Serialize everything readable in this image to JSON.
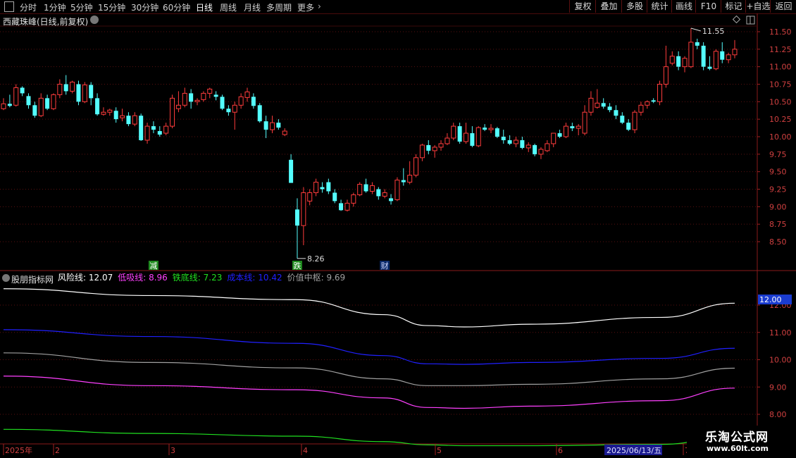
{
  "toolbar": {
    "periods": [
      "分时",
      "1分钟",
      "5分钟",
      "15分钟",
      "30分钟",
      "60分钟",
      "日线",
      "周线",
      "月线",
      "多周期",
      "更多"
    ],
    "active_period": "日线",
    "buttons": [
      "复权",
      "叠加",
      "多股",
      "统计",
      "画线",
      "F10",
      "标记",
      "+自选",
      "返回"
    ]
  },
  "main_panel": {
    "title": "西藏珠峰(日线,前复权)",
    "high_label": "11.55",
    "low_label": "8.26"
  },
  "events": [
    {
      "text": "减",
      "bg": "#1e8a1e",
      "fg": "#ffffff"
    },
    {
      "text": "跌",
      "bg": "#1e8a1e",
      "fg": "#ffffff"
    },
    {
      "text": "财",
      "bg": "#0a2a6a",
      "fg": "#d0d8ff"
    }
  ],
  "indicator": {
    "name": "股朋指标网",
    "lines": [
      {
        "label": "风险线: 12.07",
        "color": "#ffffff"
      },
      {
        "label": "低吸线: 8.96",
        "color": "#ff40ff"
      },
      {
        "label": "铁底线: 7.23",
        "color": "#20e020"
      },
      {
        "label": "成本线: 10.42",
        "color": "#2020ff"
      },
      {
        "label": "价值中枢: 9.69",
        "color": "#a0a0a0"
      }
    ],
    "current_value_tag": "12.00"
  },
  "date_axis": {
    "labels": [
      "2025年",
      "2",
      "3",
      "4",
      "5",
      "6",
      "7"
    ],
    "cursor_date": "2025/06/13/五"
  },
  "watermark": {
    "title": "乐淘公式网",
    "url": "www.60lt.com"
  },
  "chart_data": [
    {
      "type": "candlestick",
      "title": "西藏珠峰(日线,前复权)",
      "ylim": [
        8.3,
        11.65
      ],
      "yticks": [
        "11.50",
        "11.25",
        "11.00",
        "10.75",
        "10.50",
        "10.25",
        "10.00",
        "9.75",
        "9.50",
        "9.25",
        "9.00",
        "8.75",
        "8.50"
      ],
      "ohlc": [
        [
          10.4,
          10.55,
          10.38,
          10.47
        ],
        [
          10.47,
          10.6,
          10.42,
          10.44
        ],
        [
          10.45,
          10.75,
          10.43,
          10.7
        ],
        [
          10.7,
          10.72,
          10.58,
          10.62
        ],
        [
          10.58,
          10.62,
          10.4,
          10.45
        ],
        [
          10.45,
          10.5,
          10.27,
          10.3
        ],
        [
          10.3,
          10.62,
          10.28,
          10.55
        ],
        [
          10.55,
          10.6,
          10.38,
          10.4
        ],
        [
          10.4,
          10.62,
          10.38,
          10.6
        ],
        [
          10.6,
          10.82,
          10.55,
          10.75
        ],
        [
          10.75,
          10.88,
          10.6,
          10.65
        ],
        [
          10.65,
          10.8,
          10.62,
          10.78
        ],
        [
          10.75,
          10.8,
          10.45,
          10.5
        ],
        [
          10.5,
          10.78,
          10.48,
          10.74
        ],
        [
          10.74,
          10.78,
          10.45,
          10.55
        ],
        [
          10.55,
          10.62,
          10.3,
          10.32
        ],
        [
          10.32,
          10.42,
          10.3,
          10.35
        ],
        [
          10.35,
          10.4,
          10.3,
          10.38
        ],
        [
          10.37,
          10.42,
          10.2,
          10.25
        ],
        [
          10.27,
          10.4,
          10.22,
          10.3
        ],
        [
          10.3,
          10.35,
          10.15,
          10.18
        ],
        [
          10.18,
          10.35,
          10.15,
          10.3
        ],
        [
          10.3,
          10.33,
          9.94,
          9.95
        ],
        [
          9.95,
          10.2,
          9.9,
          10.15
        ],
        [
          10.15,
          10.22,
          10.05,
          10.1
        ],
        [
          10.08,
          10.15,
          10.0,
          10.03
        ],
        [
          10.05,
          10.2,
          10.02,
          10.15
        ],
        [
          10.15,
          10.6,
          10.12,
          10.55
        ],
        [
          10.4,
          10.65,
          10.35,
          10.45
        ],
        [
          10.45,
          10.7,
          10.42,
          10.62
        ],
        [
          10.62,
          10.68,
          10.4,
          10.5
        ],
        [
          10.5,
          10.55,
          10.45,
          10.52
        ],
        [
          10.53,
          10.65,
          10.5,
          10.62
        ],
        [
          10.62,
          10.7,
          10.55,
          10.68
        ],
        [
          10.6,
          10.65,
          10.52,
          10.57
        ],
        [
          10.57,
          10.6,
          10.38,
          10.4
        ],
        [
          10.4,
          10.45,
          10.3,
          10.35
        ],
        [
          10.35,
          10.5,
          10.1,
          10.45
        ],
        [
          10.45,
          10.62,
          10.4,
          10.57
        ],
        [
          10.56,
          10.7,
          10.5,
          10.64
        ],
        [
          10.57,
          10.62,
          10.4,
          10.44
        ],
        [
          10.45,
          10.48,
          10.2,
          10.22
        ],
        [
          10.22,
          10.3,
          9.98,
          10.1
        ],
        [
          10.1,
          10.3,
          10.05,
          10.2
        ],
        [
          10.2,
          10.25,
          10.1,
          10.13
        ],
        [
          10.03,
          10.12,
          10.01,
          10.08
        ],
        [
          9.67,
          9.75,
          9.34,
          9.34
        ],
        [
          8.96,
          9.12,
          8.26,
          8.73
        ],
        [
          8.73,
          9.28,
          8.45,
          9.2
        ],
        [
          9.08,
          9.25,
          9.02,
          9.2
        ],
        [
          9.2,
          9.4,
          9.15,
          9.35
        ],
        [
          9.28,
          9.35,
          9.2,
          9.25
        ],
        [
          9.35,
          9.4,
          9.18,
          9.22
        ],
        [
          9.2,
          9.25,
          9.05,
          9.08
        ],
        [
          9.05,
          9.1,
          8.94,
          8.95
        ],
        [
          8.95,
          9.1,
          8.93,
          9.05
        ],
        [
          9.05,
          9.2,
          9.0,
          9.17
        ],
        [
          9.17,
          9.35,
          9.15,
          9.32
        ],
        [
          9.32,
          9.4,
          9.2,
          9.22
        ],
        [
          9.22,
          9.35,
          9.18,
          9.3
        ],
        [
          9.25,
          9.28,
          9.1,
          9.15
        ],
        [
          9.15,
          9.25,
          9.12,
          9.2
        ],
        [
          9.12,
          9.18,
          9.03,
          9.08
        ],
        [
          9.1,
          9.42,
          9.08,
          9.38
        ],
        [
          9.38,
          9.55,
          9.3,
          9.35
        ],
        [
          9.35,
          9.65,
          9.32,
          9.45
        ],
        [
          9.45,
          9.75,
          9.42,
          9.7
        ],
        [
          9.7,
          9.9,
          9.65,
          9.88
        ],
        [
          9.88,
          9.95,
          9.75,
          9.8
        ],
        [
          9.8,
          9.88,
          9.7,
          9.85
        ],
        [
          9.85,
          9.95,
          9.8,
          9.9
        ],
        [
          9.9,
          10.05,
          9.88,
          9.98
        ],
        [
          9.98,
          10.2,
          9.95,
          10.15
        ],
        [
          10.15,
          10.2,
          9.9,
          9.93
        ],
        [
          9.93,
          10.2,
          9.9,
          10.05
        ],
        [
          10.05,
          10.15,
          9.85,
          9.87
        ],
        [
          9.87,
          10.15,
          9.85,
          10.13
        ],
        [
          10.13,
          10.18,
          10.08,
          10.1
        ],
        [
          10.1,
          10.18,
          10.05,
          10.12
        ],
        [
          10.12,
          10.14,
          9.98,
          10.0
        ],
        [
          10.0,
          10.1,
          9.9,
          9.95
        ],
        [
          9.95,
          10.02,
          9.88,
          9.9
        ],
        [
          9.9,
          10.0,
          9.85,
          9.95
        ],
        [
          9.95,
          10.0,
          9.82,
          9.84
        ],
        [
          9.84,
          9.92,
          9.78,
          9.88
        ],
        [
          9.88,
          9.9,
          9.72,
          9.75
        ],
        [
          9.75,
          9.85,
          9.68,
          9.82
        ],
        [
          9.8,
          9.95,
          9.78,
          9.9
        ],
        [
          9.9,
          10.05,
          9.85,
          10.05
        ],
        [
          10.05,
          10.1,
          9.98,
          10.0
        ],
        [
          10.0,
          10.2,
          9.98,
          10.15
        ],
        [
          10.15,
          10.2,
          10.08,
          10.12
        ],
        [
          10.12,
          10.18,
          10.02,
          10.15
        ],
        [
          10.05,
          10.45,
          10.02,
          10.35
        ],
        [
          10.35,
          10.65,
          10.3,
          10.55
        ],
        [
          10.42,
          10.68,
          10.4,
          10.48
        ],
        [
          10.48,
          10.55,
          10.4,
          10.43
        ],
        [
          10.43,
          10.48,
          10.35,
          10.38
        ],
        [
          10.38,
          10.45,
          10.25,
          10.3
        ],
        [
          10.3,
          10.35,
          10.18,
          10.2
        ],
        [
          10.2,
          10.25,
          10.08,
          10.1
        ],
        [
          10.1,
          10.38,
          10.05,
          10.35
        ],
        [
          10.35,
          10.5,
          10.3,
          10.45
        ],
        [
          10.45,
          10.52,
          10.4,
          10.5
        ],
        [
          10.52,
          10.55,
          10.48,
          10.5
        ],
        [
          10.5,
          10.8,
          10.45,
          10.75
        ],
        [
          10.75,
          11.3,
          10.7,
          11.0
        ],
        [
          11.05,
          11.22,
          11.02,
          11.15
        ],
        [
          11.15,
          11.22,
          10.95,
          11.0
        ],
        [
          11.0,
          11.15,
          10.92,
          11.12
        ],
        [
          11.0,
          11.55,
          10.98,
          11.35
        ],
        [
          11.35,
          11.4,
          11.25,
          11.3
        ],
        [
          11.3,
          11.35,
          10.95,
          11.0
        ],
        [
          11.0,
          11.15,
          10.95,
          10.97
        ],
        [
          10.97,
          11.25,
          10.95,
          11.22
        ],
        [
          11.22,
          11.35,
          11.05,
          11.1
        ],
        [
          11.1,
          11.2,
          11.05,
          11.17
        ],
        [
          11.17,
          11.38,
          11.12,
          11.25
        ]
      ],
      "events": [
        {
          "index": 24,
          "text": "减"
        },
        {
          "index": 47,
          "text": "跌"
        },
        {
          "index": 61,
          "text": "财"
        }
      ]
    },
    {
      "type": "line",
      "title": "股朋指标网",
      "ylim": [
        7.5,
        12.4
      ],
      "yticks": [
        "12.00",
        "11.00",
        "10.00",
        "9.00",
        "8.00"
      ],
      "series": [
        {
          "name": "风险线",
          "color": "#ffffff",
          "points": [
            [
              0,
              12.6
            ],
            [
              0.2,
              12.35
            ],
            [
              0.4,
              12.2
            ],
            [
              0.52,
              11.65
            ],
            [
              0.58,
              11.25
            ],
            [
              0.63,
              11.2
            ],
            [
              0.72,
              11.3
            ],
            [
              0.9,
              11.55
            ],
            [
              1.0,
              12.07
            ]
          ]
        },
        {
          "name": "成本线",
          "color": "#2020ff",
          "points": [
            [
              0,
              11.1
            ],
            [
              0.2,
              10.85
            ],
            [
              0.4,
              10.6
            ],
            [
              0.52,
              10.15
            ],
            [
              0.58,
              9.85
            ],
            [
              0.63,
              9.83
            ],
            [
              0.72,
              9.9
            ],
            [
              0.9,
              10.05
            ],
            [
              1.0,
              10.42
            ]
          ]
        },
        {
          "name": "价值中枢",
          "color": "#a0a0a0",
          "points": [
            [
              0,
              10.25
            ],
            [
              0.2,
              9.9
            ],
            [
              0.4,
              9.7
            ],
            [
              0.52,
              9.3
            ],
            [
              0.58,
              9.05
            ],
            [
              0.63,
              9.05
            ],
            [
              0.72,
              9.1
            ],
            [
              0.9,
              9.3
            ],
            [
              1.0,
              9.69
            ]
          ]
        },
        {
          "name": "低吸线",
          "color": "#ff40ff",
          "points": [
            [
              0,
              9.4
            ],
            [
              0.2,
              9.05
            ],
            [
              0.4,
              8.9
            ],
            [
              0.52,
              8.6
            ],
            [
              0.58,
              8.25
            ],
            [
              0.63,
              8.22
            ],
            [
              0.72,
              8.3
            ],
            [
              0.9,
              8.5
            ],
            [
              1.0,
              8.96
            ]
          ]
        },
        {
          "name": "铁底线",
          "color": "#20e020",
          "points": [
            [
              0,
              7.45
            ],
            [
              0.2,
              7.3
            ],
            [
              0.4,
              7.2
            ],
            [
              0.52,
              7.0
            ],
            [
              0.58,
              6.88
            ],
            [
              0.63,
              6.85
            ],
            [
              0.72,
              6.85
            ],
            [
              0.9,
              6.9
            ],
            [
              1.0,
              7.23
            ]
          ]
        }
      ]
    }
  ]
}
